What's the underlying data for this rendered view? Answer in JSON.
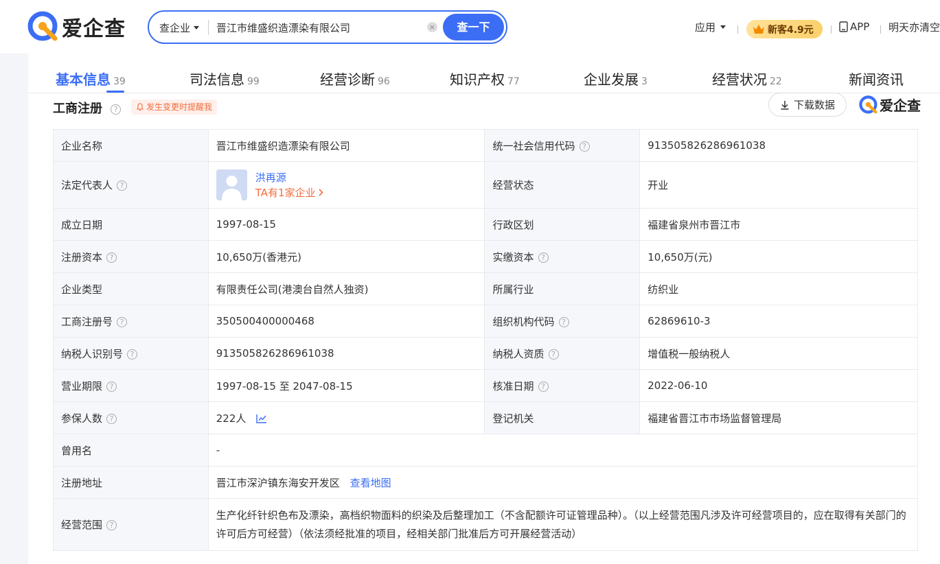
{
  "header": {
    "brand": "爱企查",
    "search": {
      "type_label": "查企业",
      "value": "晋江市维盛织造漂染有限公司",
      "clear_glyph": "×",
      "button_label": "查一下"
    },
    "apps_label": "应用",
    "vip_label": "新客4.9元",
    "app_label": "APP",
    "user_label": "明天亦清空"
  },
  "tabs": [
    {
      "label": "基本信息",
      "count": "39"
    },
    {
      "label": "司法信息",
      "count": "99"
    },
    {
      "label": "经营诊断",
      "count": "96"
    },
    {
      "label": "知识产权",
      "count": "77"
    },
    {
      "label": "企业发展",
      "count": "3"
    },
    {
      "label": "经营状况",
      "count": "22"
    },
    {
      "label": "新闻资讯",
      "count": ""
    }
  ],
  "section": {
    "title": "工商注册",
    "remind_label": "发生变更时提醒我",
    "download_label": "下载数据",
    "watermark": "爱企查"
  },
  "info": {
    "company_name_label": "企业名称",
    "company_name": "晋江市维盛织造漂染有限公司",
    "credit_code_label": "统一社会信用代码",
    "credit_code": "913505826286961038",
    "legal_rep_label": "法定代表人",
    "legal_rep_name": "洪再源",
    "legal_rep_link": "TA有1家企业",
    "status_label": "经营状态",
    "status": "开业",
    "founded_label": "成立日期",
    "founded": "1997-08-15",
    "region_label": "行政区划",
    "region": "福建省泉州市晋江市",
    "reg_capital_label": "注册资本",
    "reg_capital": "10,650万(香港元)",
    "paid_capital_label": "实缴资本",
    "paid_capital": "10,650万(元)",
    "type_label": "企业类型",
    "type": "有限责任公司(港澳台自然人独资)",
    "industry_label": "所属行业",
    "industry": "纺织业",
    "reg_no_label": "工商注册号",
    "reg_no": "350500400000468",
    "org_code_label": "组织机构代码",
    "org_code": "62869610-3",
    "taxpayer_id_label": "纳税人识别号",
    "taxpayer_id": "913505826286961038",
    "taxpayer_qual_label": "纳税人资质",
    "taxpayer_qual": "增值税一般纳税人",
    "term_label": "营业期限",
    "term": "1997-08-15 至 2047-08-15",
    "approval_label": "核准日期",
    "approval": "2022-06-10",
    "insured_label": "参保人数",
    "insured": "222人",
    "authority_label": "登记机关",
    "authority": "福建省晋江市市场监督管理局",
    "former_name_label": "曾用名",
    "former_name": "-",
    "address_label": "注册地址",
    "address": "晋江市深沪镇东海安开发区",
    "map_link": "查看地图",
    "scope_label": "经营范围",
    "scope": "生产化纤针织色布及漂染，高档织物面料的织染及后整理加工（不含配额许可证管理品种）。（以上经营范围凡涉及许可经营项目的，应在取得有关部门的许可后方可经营）（依法须经批准的项目，经相关部门批准后方可开展经营活动）"
  },
  "help_glyph": "?",
  "colors": {
    "accent": "#3b6ef5",
    "logo_orange": "#f7a21b",
    "remind": "#f06d3e"
  }
}
